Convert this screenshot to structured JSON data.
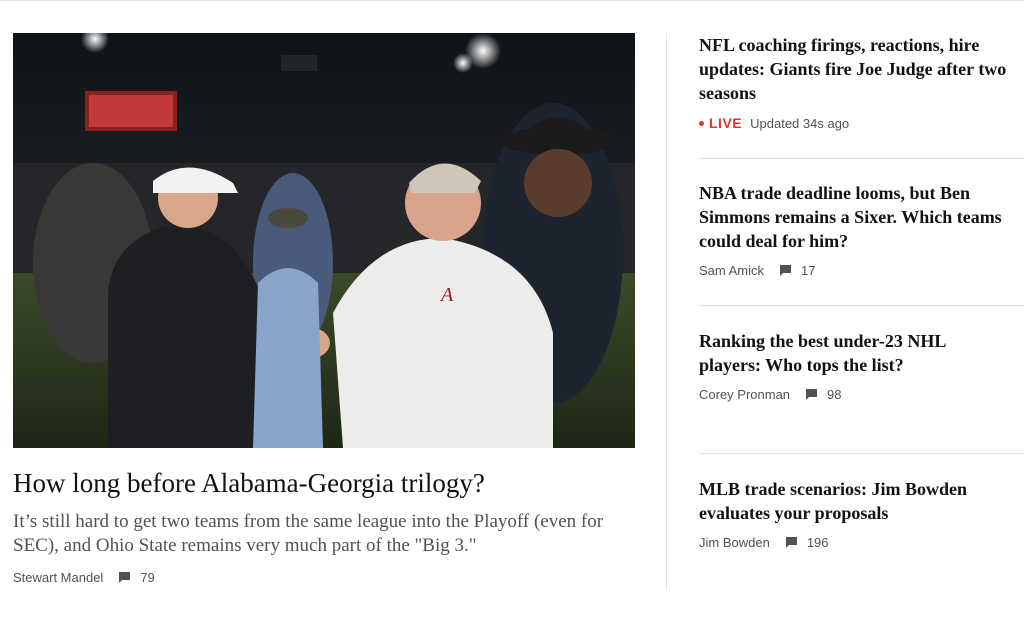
{
  "lead": {
    "photo_alt": "Kirby Smart and Nick Saban shaking hands on the field after the game",
    "headline": "How long before Alabama-Georgia trilogy?",
    "dek": "It’s still hard to get two teams from the same league into the Playoff (even for SEC), and Ohio State remains very much part of the \"Big 3.\"",
    "author": "Stewart Mandel",
    "comments": "79"
  },
  "rail": [
    {
      "headline": "NFL coaching firings, reactions, hire updates: Giants fire Joe Judge after two seasons",
      "live_label": "LIVE",
      "updated": "Updated 34s ago"
    },
    {
      "headline": "NBA trade deadline looms, but Ben Simmons remains a Sixer. Which teams could deal for him?",
      "author": "Sam Amick",
      "comments": "17"
    },
    {
      "headline": "Ranking the best under-23 NHL players: Who tops the list?",
      "author": "Corey Pronman",
      "comments": "98"
    },
    {
      "headline": "MLB trade scenarios: Jim Bowden evaluates your proposals",
      "author": "Jim Bowden",
      "comments": "196"
    }
  ],
  "icons": {
    "comment": "comment-bubble-icon",
    "live": "live-dot-icon"
  },
  "colors": {
    "live": "#e3332e",
    "meta": "#52524e",
    "divider": "#e3e3e3"
  }
}
